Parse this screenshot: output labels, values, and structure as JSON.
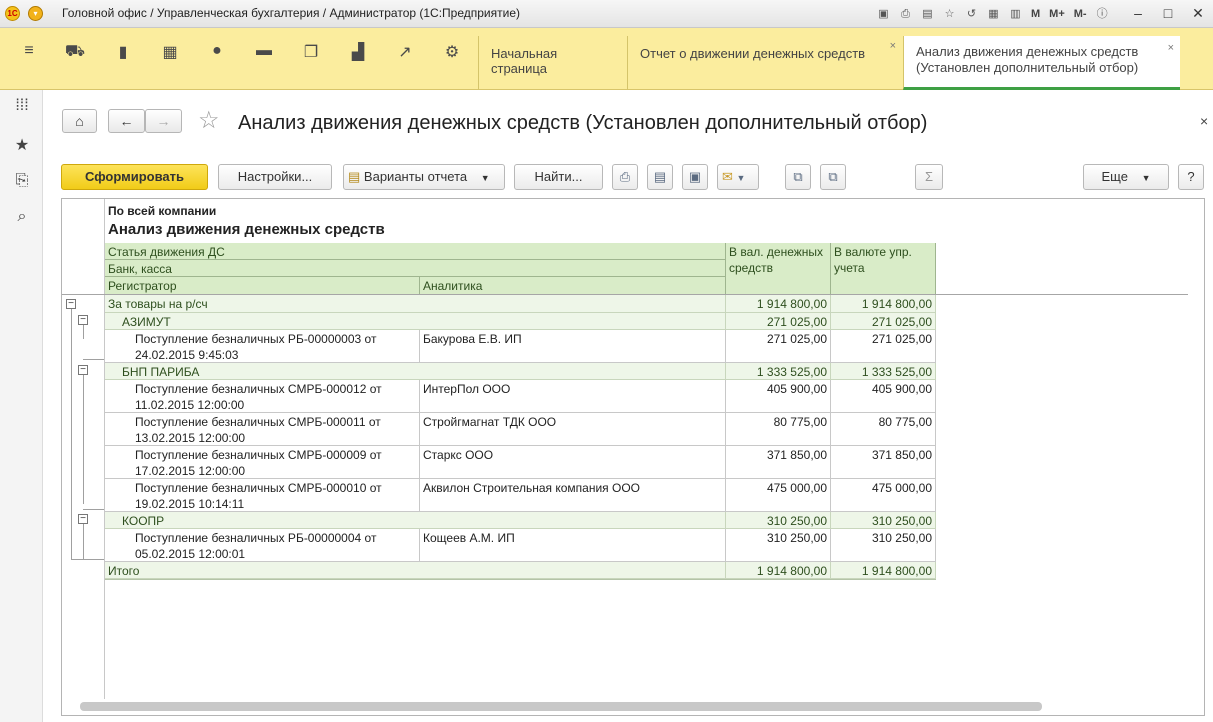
{
  "window": {
    "title": "Головной офис / Управленческая бухгалтерия / Администратор  (1С:Предприятие)",
    "logo_text": "1С",
    "tools": [
      "M",
      "M+",
      "M-"
    ]
  },
  "tabs": [
    {
      "label": "Начальная страница"
    },
    {
      "label": "Отчет о движении денежных средств",
      "close": "×"
    },
    {
      "label": "Анализ движения денежных средств (Установлен дополнительный отбор)",
      "close": "×"
    }
  ],
  "page": {
    "title": "Анализ движения денежных средств (Установлен дополнительный отбор)"
  },
  "toolbar": {
    "generate": "Сформировать",
    "settings": "Настройки...",
    "variants": "Варианты отчета",
    "find": "Найти...",
    "more": "Еще",
    "help": "?"
  },
  "report": {
    "scope": "По всей компании",
    "title": "Анализ движения денежных средств",
    "headers": {
      "article": "Статья движения ДС",
      "bank": "Банк, касса",
      "registrar": "Регистратор",
      "analytics": "Аналитика",
      "cur_money": "В вал. денежных средств",
      "cur_mgmt": "В валюте упр. учета"
    },
    "article_group": {
      "name": "За товары на р/сч",
      "v1": "1 914 800,00",
      "v2": "1 914 800,00"
    },
    "groups": [
      {
        "name": "АЗИМУТ",
        "v1": "271 025,00",
        "v2": "271 025,00",
        "rows": [
          {
            "reg1": "Поступление безналичных РБ-00000003 от",
            "reg2": "24.02.2015 9:45:03",
            "analytics": "Бакурова Е.В. ИП",
            "v1": "271 025,00",
            "v2": "271 025,00"
          }
        ]
      },
      {
        "name": "БНП ПАРИБА",
        "v1": "1 333 525,00",
        "v2": "1 333 525,00",
        "rows": [
          {
            "reg1": "Поступление безналичных СМРБ-000012 от",
            "reg2": "11.02.2015 12:00:00",
            "analytics": "ИнтерПол ООО",
            "v1": "405 900,00",
            "v2": "405 900,00"
          },
          {
            "reg1": "Поступление безналичных СМРБ-000011 от",
            "reg2": "13.02.2015 12:00:00",
            "analytics": "Стройгмагнат ТДК ООО",
            "v1": "80 775,00",
            "v2": "80 775,00"
          },
          {
            "reg1": "Поступление безналичных СМРБ-000009 от",
            "reg2": "17.02.2015 12:00:00",
            "analytics": "Старкс ООО",
            "v1": "371 850,00",
            "v2": "371 850,00"
          },
          {
            "reg1": "Поступление безналичных СМРБ-000010 от",
            "reg2": "19.02.2015 10:14:11",
            "analytics": "Аквилон Строительная компания ООО",
            "v1": "475 000,00",
            "v2": "475 000,00"
          }
        ]
      },
      {
        "name": "КООПР",
        "v1": "310 250,00",
        "v2": "310 250,00",
        "rows": [
          {
            "reg1": "Поступление безналичных РБ-00000004 от",
            "reg2": "05.02.2015 12:00:01",
            "analytics": "Кощеев А.М. ИП",
            "v1": "310 250,00",
            "v2": "310 250,00"
          }
        ]
      }
    ],
    "total": {
      "label": "Итого",
      "v1": "1 914 800,00",
      "v2": "1 914 800,00"
    }
  }
}
